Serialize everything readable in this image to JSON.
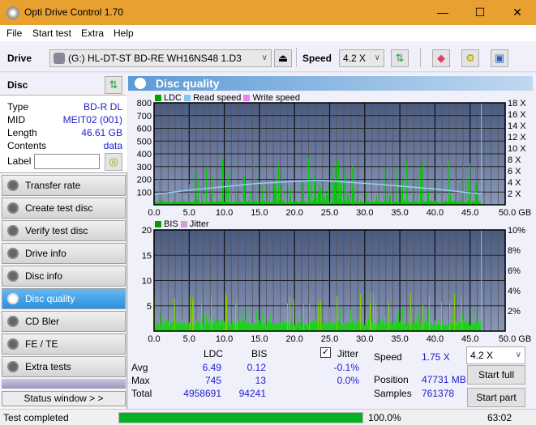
{
  "window": {
    "title": "Opti Drive Control 1.70",
    "minimize": "—",
    "maximize": "☐",
    "close": "✕"
  },
  "menu": [
    "File",
    "Start test",
    "Extra",
    "Help"
  ],
  "toolbar": {
    "drive_label": "Drive",
    "drive_value": "(G:)  HL-DT-ST BD-RE  WH16NS48 1.D3",
    "speed_label": "Speed",
    "speed_value": "4.2 X"
  },
  "disc": {
    "header": "Disc",
    "fields": [
      {
        "k": "Type",
        "v": "BD-R DL"
      },
      {
        "k": "MID",
        "v": "MEIT02 (001)"
      },
      {
        "k": "Length",
        "v": "46.61 GB"
      },
      {
        "k": "Contents",
        "v": "data"
      }
    ],
    "label_label": "Label",
    "label_value": ""
  },
  "nav": [
    "Transfer rate",
    "Create test disc",
    "Verify test disc",
    "Drive info",
    "Disc info",
    "Disc quality",
    "CD Bler",
    "FE / TE",
    "Extra tests"
  ],
  "nav_active": 5,
  "status_window": "Status window > >",
  "panel_title": "Disc quality",
  "chart_data": [
    {
      "type": "bar",
      "title": "LDC",
      "legend": [
        "LDC",
        "Read speed",
        "Write speed"
      ],
      "legend_colors": [
        "#00a000",
        "#80c8f0",
        "#f080f0"
      ],
      "x_ticks": [
        "0.0",
        "5.0",
        "10.0",
        "15.0",
        "20.0",
        "25.0",
        "30.0",
        "35.0",
        "40.0",
        "45.0",
        "50.0 GB"
      ],
      "xlim": [
        0,
        50
      ],
      "y_ticks": [
        "100",
        "200",
        "300",
        "400",
        "500",
        "600",
        "700",
        "800"
      ],
      "ylim": [
        0,
        800
      ],
      "y2_ticks": [
        "2 X",
        "4 X",
        "6 X",
        "8 X",
        "10 X",
        "12 X",
        "14 X",
        "16 X",
        "18 X"
      ],
      "y2lim": [
        0,
        18
      ],
      "data_end_gb": 46.61,
      "read_speed": [
        [
          0,
          1.8
        ],
        [
          5,
          2.6
        ],
        [
          10,
          3.2
        ],
        [
          15,
          3.8
        ],
        [
          20,
          4.1
        ],
        [
          23.5,
          4.3
        ],
        [
          25,
          4.2
        ],
        [
          30,
          3.8
        ],
        [
          35,
          3.3
        ],
        [
          40,
          2.8
        ],
        [
          45,
          2.1
        ],
        [
          46.6,
          2.0
        ]
      ]
    },
    {
      "type": "bar",
      "title": "BIS",
      "legend": [
        "BIS",
        "Jitter"
      ],
      "legend_colors": [
        "#00a000",
        "#d0a0d0"
      ],
      "x_ticks": [
        "0.0",
        "5.0",
        "10.0",
        "15.0",
        "20.0",
        "25.0",
        "30.0",
        "35.0",
        "40.0",
        "45.0",
        "50.0 GB"
      ],
      "xlim": [
        0,
        50
      ],
      "y_ticks": [
        "5",
        "10",
        "15",
        "20"
      ],
      "ylim": [
        0,
        20
      ],
      "y2_ticks": [
        "2%",
        "4%",
        "6%",
        "8%",
        "10%"
      ],
      "y2lim": [
        0,
        10
      ],
      "data_end_gb": 46.61
    }
  ],
  "stats": {
    "col_ldc": "LDC",
    "col_bis": "BIS",
    "rows": [
      {
        "k": "Avg",
        "ldc": "6.49",
        "bis": "0.12",
        "jit": "-0.1%"
      },
      {
        "k": "Max",
        "ldc": "745",
        "bis": "13",
        "jit": "0.0%"
      },
      {
        "k": "Total",
        "ldc": "4958691",
        "bis": "94241",
        "jit": ""
      }
    ],
    "jitter_label": "Jitter",
    "jitter_checked": true,
    "speed_label": "Speed",
    "speed_value": "1.75 X",
    "position_label": "Position",
    "position_value": "47731 MB",
    "samples_label": "Samples",
    "samples_value": "761378",
    "speed_select": "4.2 X",
    "start_full": "Start full",
    "start_part": "Start part"
  },
  "status": {
    "text": "Test completed",
    "progress": 100.0,
    "progress_text": "100.0%",
    "time": "63:02"
  }
}
